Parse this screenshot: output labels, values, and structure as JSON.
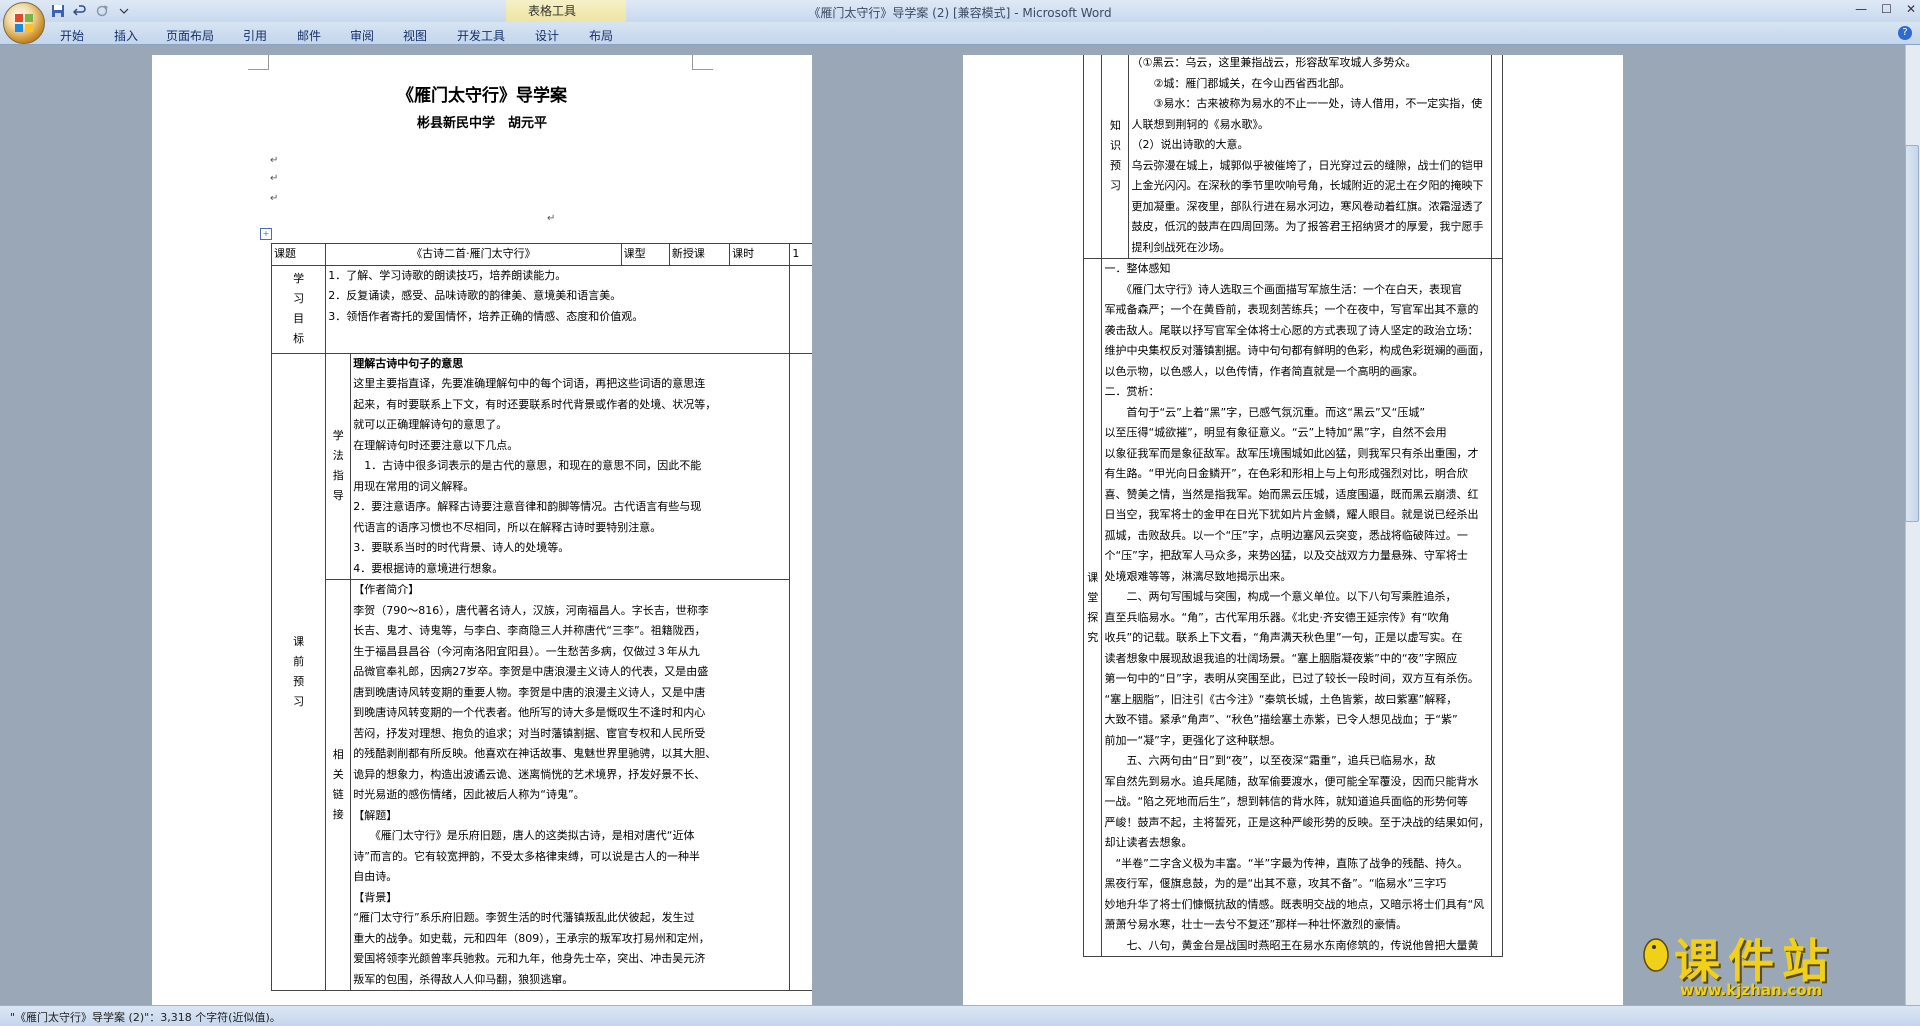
{
  "window": {
    "title": "《雁门太守行》导学案 (2) [兼容模式]",
    "app_name": "Microsoft Word",
    "contextual_tab_group": "表格工具"
  },
  "quick_access": {
    "save_icon": "save-icon",
    "undo_icon": "undo-icon",
    "redo_icon": "redo-icon",
    "customize_icon": "chevron-down-icon"
  },
  "ribbon": {
    "tabs": [
      "开始",
      "插入",
      "页面布局",
      "引用",
      "邮件",
      "审阅",
      "视图",
      "开发工具",
      "设计",
      "布局"
    ]
  },
  "page1": {
    "title": "《雁门太守行》导学案",
    "author": "彬县新民中学　胡元平",
    "table": {
      "r1": {
        "k_label": "课题",
        "k_value": "《古诗二首·雁门太守行》",
        "type_label": "课型",
        "type_value": "新授课",
        "hours_label": "课时",
        "hours_value": "1"
      },
      "goals_label": [
        "学",
        "习",
        "目",
        "标"
      ],
      "goals": [
        "1．了解、学习诗歌的朗读技巧，培养朗读能力。",
        "2．反复诵读，感受、品味诗歌的韵律美、意境美和语言美。",
        "3．领悟作者寄托的爱国情怀，培养正确的情感、态度和价值观。"
      ],
      "preview_label": [
        "课",
        "前",
        "预",
        "习"
      ],
      "method_label": [
        "学",
        "法",
        "指",
        "导"
      ],
      "method": [
        "理解古诗中句子的意思",
        "这里主要指直译，先要准确理解句中的每个词语，再把这些词语的意思连",
        "起来，有时要联系上下文，有时还要联系时代背景或作者的处境、状况等，",
        "就可以正确理解诗句的意思了。",
        "在理解诗句时还要注意以下几点。",
        "　1．古诗中很多词表示的是古代的意思，和现在的意思不同，因此不能",
        "用现在常用的词义解释。",
        "2．要注意语序。解释古诗要注意音律和韵脚等情况。古代语言有些与现",
        "代语言的语序习惯也不尽相同，所以在解释古诗时要特别注意。",
        "3．要联系当时的时代背景、诗人的处境等。",
        "4．要根据诗的意境进行想象。"
      ],
      "link_label": [
        "相",
        "关",
        "链",
        "接"
      ],
      "link": [
        "【作者简介】",
        "李贺（790～816），唐代著名诗人，汉族，河南福昌人。字长吉，世称李",
        "长吉、鬼才、诗鬼等，与李白、李商隐三人并称唐代“三李”。祖籍陇西，",
        "生于福昌县昌谷（今河南洛阳宜阳县）。一生愁苦多病，仅做过３年从九",
        "品微官奉礼郎，因病27岁卒。李贺是中唐浪漫主义诗人的代表，又是由盛",
        "唐到晚唐诗风转变期的重要人物。李贺是中唐的浪漫主义诗人，又是中唐",
        "到晚唐诗风转变期的一个代表者。他所写的诗大多是慨叹生不逢时和内心",
        "苦闷，抒发对理想、抱负的追求；对当时藩镇割据、宦官专权和人民所受",
        "的残酷剥削都有所反映。他喜欢在神话故事、鬼魅世界里驰骋，以其大胆、",
        "诡异的想象力，构造出波谲云诡、迷离惝恍的艺术境界，抒发好景不长、",
        "时光易逝的感伤情绪，因此被后人称为“诗鬼”。",
        "【解题】",
        "　　《雁门太守行》是乐府旧题，唐人的这类拟古诗，是相对唐代“近体",
        "诗”而言的。它有较宽押韵，不受太多格律束缚，可以说是古人的一种半",
        "自由诗。",
        "【背景】",
        "“雁门太守行”系乐府旧题。李贺生活的时代藩镇叛乱此伏彼起，发生过",
        "重大的战争。如史载，元和四年（809），王承宗的叛军攻打易州和定州，",
        "爱国将领李光颜曾率兵驰救。元和九年，他身先士卒，突出、冲击吴元济",
        "叛军的包围，杀得敌人人仰马翻，狼狈逃窜。"
      ]
    }
  },
  "page2": {
    "knowledge_label": [
      "知",
      "识",
      "预",
      "习"
    ],
    "knowledge": [
      "（①黑云：乌云，这里兼指战云，形容敌军攻城人多势众。",
      "　　②城：雁门郡城关，在今山西省西北部。",
      "　　③易水：古来被称为易水的不止一一处，诗人借用，不一定实指，使",
      "人联想到荆轲的《易水歌》。",
      "（2）说出诗歌的大意。",
      "乌云弥漫在城上，城郭似乎被催垮了，日光穿过云的缝隙，战士们的铠甲",
      "上金光闪闪。在深秋的季节里吹响号角，长城附近的泥土在夕阳的掩映下",
      "更加凝重。深夜里，部队行进在易水河边，寒风卷动着红旗。浓霜湿透了",
      "鼓皮，低沉的鼓声在四周回荡。为了报答君王招纳贤才的厚爱，我宁愿手",
      "提利剑战死在沙场。"
    ],
    "explore_label": [
      "课",
      "堂",
      "探",
      "究"
    ],
    "explore": [
      "一．整体感知",
      "　　《雁门太守行》诗人选取三个画面描写军旅生活：一个在白天，表现官",
      "军戒备森严；一个在黄昏前，表现刻苦练兵；一个在夜中，写官军出其不意的",
      "袭击敌人。尾联以抒写官军全体将士心愿的方式表现了诗人坚定的政治立场：",
      "维护中央集权反对藩镇割据。诗中句句都有鲜明的色彩，构成色彩斑斓的画面，",
      "以色示物，以色感人，以色传情，作者简直就是一个高明的画家。",
      "二．赏析：",
      "　　首句于“云”上着“黑”字，已感气氛沉重。而这“黑云”又“压城”",
      "以至压得“城欲摧”，明显有象征意义。“云”上特加“黑”字，自然不会用",
      "以象征我军而是象征敌军。敌军压境围城如此凶猛，则我军只有杀出重围，才",
      "有生路。“甲光向日金鳞开”，在色彩和形相上与上句形成强烈对比，明合欣",
      "喜、赞美之情，当然是指我军。始而黑云压城，适度围逼，既而黑云崩溃、红",
      "日当空，我军将士的金甲在日光下犹如片片金鳞，耀人眼目。就是说已经杀出",
      "孤城，击败敌兵。以一个“压”字，点明边塞风云突变，悉战将临破阵过。一",
      "个“压”字，把敌军人马众多，来势凶猛，以及交战双方力量悬殊、守军将士",
      "处境艰难等等，淋漓尽致地揭示出来。",
      "　　二、两句写围城与突围，构成一个意义单位。以下八句写乘胜追杀，",
      "直至兵临易水。“角”，古代军用乐器。《北史·齐安德王延宗传》有“吹角",
      "收兵”的记载。联系上下文看，“角声满天秋色里”一句，正是以虚写实。在",
      "读者想象中展现敌退我追的壮阔场景。“塞上胭脂凝夜紫”中的“夜”字照应",
      "第一句中的“日”字，表明从突围至此，已过了较长一段时间，双方互有杀伤。",
      "“塞上胭脂”，旧注引《古今注》“秦筑长城，土色皆紫，故曰紫塞”解释，",
      "大致不错。紧承“角声”、“秋色”描绘塞土赤紫，已令人想见战血；于“紫”",
      "前加一“凝”字，更强化了这种联想。",
      "　　五、六两句由“日”到“夜”，以至夜深“霜重”，追兵已临易水，敌",
      "军自然先到易水。追兵尾随，敌军偷要渡水，便可能全军覆没，因而只能背水",
      "一战。“陷之死地而后生”，想到韩信的背水阵，就知道追兵面临的形势何等",
      "严峻！鼓声不起，主将誓死，正是这种严峻形势的反映。至于决战的结果如何，",
      "却让读者去想象。",
      "　“半卷”二字含义极为丰富。“半”字最为传神，直陈了战争的残酷、持久。",
      "黑夜行军，偃旗息鼓，为的是“出其不意，攻其不备”。“临易水”三字巧",
      "妙地升华了将士们慷慨抗敌的情感。既表明交战的地点，又暗示将士们具有“风",
      "萧萧兮易水寒，壮士一去兮不复还”那样一种壮怀激烈的豪情。",
      "　　七、八句，黄金台是战国时燕昭王在易水东南修筑的，传说他曾把大量黄"
    ]
  },
  "statusbar": {
    "text": "\"《雁门太守行》导学案 (2)\"：3,318 个字符(近似值)。"
  },
  "watermark": {
    "brand": "课件站",
    "url": "www.kjzhan.com"
  }
}
